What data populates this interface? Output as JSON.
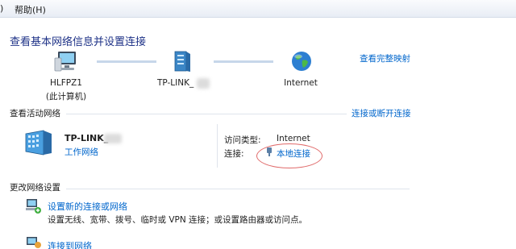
{
  "menu": {
    "left_fragment": ")",
    "help": "帮助(H)"
  },
  "page_title": "查看基本网络信息并设置连接",
  "map": {
    "computer_name": "HLFPZ1",
    "computer_sub": "(此计算机)",
    "router_name": "TP-LINK_",
    "internet_name": "Internet",
    "full_map_link": "查看完整映射"
  },
  "active": {
    "header": "查看活动网络",
    "connect_link": "连接或断开连接",
    "network_name": "TP-LINK_",
    "network_type": "工作网络",
    "access_type_label": "访问类型:",
    "access_type_value": "Internet",
    "connections_label": "连接:",
    "connection_link": "本地连接"
  },
  "change": {
    "header": "更改网络设置",
    "items": [
      {
        "title": "设置新的连接或网络",
        "desc": "设置无线、宽带、拨号、临时或 VPN 连接；或设置路由器或访问点。"
      },
      {
        "title": "连接到网络"
      }
    ]
  },
  "colors": {
    "title": "#1e3287",
    "link": "#0066cc",
    "annotation_oval": "#e06a6a"
  }
}
